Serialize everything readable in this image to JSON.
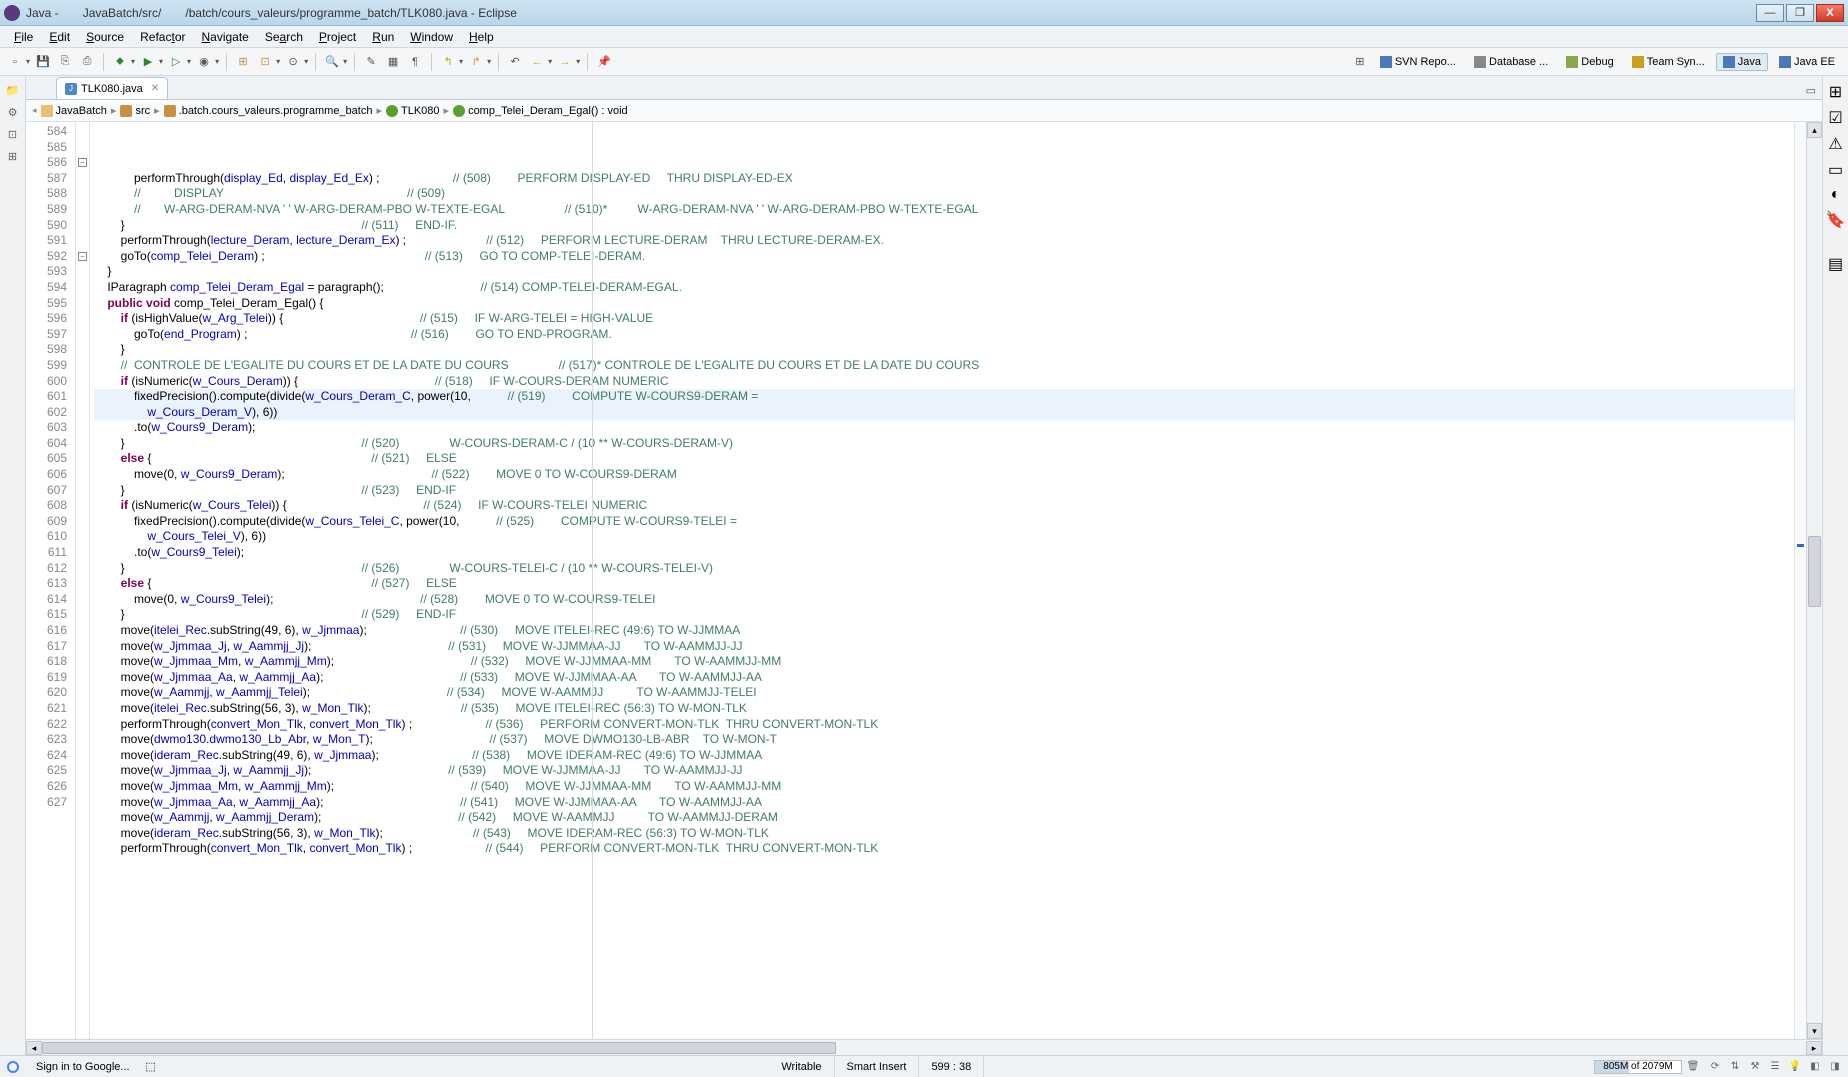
{
  "title": {
    "seg1": "Java -",
    "seg2": "JavaBatch/src/",
    "seg3": "/batch/cours_valeurs/programme_batch/TLK080.java - Eclipse"
  },
  "window_buttons": {
    "min": "—",
    "max": "❐",
    "close": "X"
  },
  "menu": [
    "File",
    "Edit",
    "Source",
    "Refactor",
    "Navigate",
    "Search",
    "Project",
    "Run",
    "Window",
    "Help"
  ],
  "perspectives": [
    {
      "label": "SVN Repo...",
      "active": false
    },
    {
      "label": "Database ...",
      "active": false
    },
    {
      "label": "Debug",
      "active": false
    },
    {
      "label": "Team Syn...",
      "active": false
    },
    {
      "label": "Java",
      "active": true
    },
    {
      "label": "Java EE",
      "active": false
    }
  ],
  "tab": {
    "name": "TLK080.java"
  },
  "breadcrumb": {
    "project": "JavaBatch",
    "src": "src",
    "pkg": ".batch.cours_valeurs.programme_batch",
    "class": "TLK080",
    "method": "comp_Telei_Deram_Egal() : void"
  },
  "code": {
    "first_line": 584,
    "highlighted": [
      598,
      599
    ],
    "fold_markers": [
      586,
      592
    ],
    "lines": [
      "            performThrough(<f>display_Ed</f>, <f>display_Ed_Ex</f>) ;                      <c>// (508)        PERFORM DISPLAY-ED     THRU DISPLAY-ED-EX</c>",
      "            <c>//          DISPLAY</c>                                                       <c>// (509)</c>",
      "            <c>//       W-ARG-DERAM-NVA ' ' W-ARG-DERAM-PBO W-TEXTE-EGAL</c>                  <c>// (510)*         W-ARG-DERAM-NVA ' ' W-ARG-DERAM-PBO W-TEXTE-EGAL</c>",
      "        }                                                                       <c>// (511)     END-IF.</c>",
      "        performThrough(<f>lecture_Deram</f>, <f>lecture_Deram_Ex</f>) ;                        <c>// (512)     PERFORM LECTURE-DERAM    THRU LECTURE-DERAM-EX.</c>",
      "        goTo(<f>comp_Telei_Deram</f>) ;                                                <c>// (513)     GO TO COMP-TELEI-DERAM.</c>",
      "    }",
      "    IParagraph <f>comp_Telei_Deram_Egal</f> = paragraph();                             <c>// (514) COMP-TELEI-DERAM-EGAL.</c>",
      "    <k>public</k> <k>void</k> comp_Telei_Deram_Egal() {",
      "        <k>if</k> (isHighValue(<f>w_Arg_Telei</f>)) {                                         <c>// (515)     IF W-ARG-TELEI = HIGH-VALUE</c>",
      "            goTo(<f>end_Program</f>) ;                                                 <c>// (516)        GO TO END-PROGRAM.</c>",
      "        }",
      "        <c>//  CONTROLE DE L'EGALITE DU COURS ET DE LA DATE DU COURS</c>               <c>// (517)* CONTROLE DE L'EGALITE DU COURS ET DE LA DATE DU COURS</c>",
      "        <k>if</k> (isNumeric(<f>w_Cours_Deram</f>)) {                                         <c>// (518)     IF W-COURS-DERAM NUMERIC</c>",
      "            fixedPrecision().compute(divide(<f>w_Cours_Deram_C</f>, power(10,           <c>// (519)        COMPUTE W-COURS9-DERAM =</c>",
      "                <f>w_Cours_Deram_V</f>), 6))",
      "            .to(<f>w_Cours9_Deram</f>);",
      "        }                                                                       <c>// (520)               W-COURS-DERAM-C / (10 ** W-COURS-DERAM-V)</c>",
      "        <k>else</k> {                                                                  <c>// (521)     ELSE</c>",
      "            move(0, <f>w_Cours9_Deram</f>);                                            <c>// (522)        MOVE 0 TO W-COURS9-DERAM</c>",
      "        }                                                                       <c>// (523)     END-IF</c>",
      "        <k>if</k> (isNumeric(<f>w_Cours_Telei</f>)) {                                         <c>// (524)     IF W-COURS-TELEI NUMERIC</c>",
      "            fixedPrecision().compute(divide(<f>w_Cours_Telei_C</f>, power(10,           <c>// (525)        COMPUTE W-COURS9-TELEI =</c>",
      "                <f>w_Cours_Telei_V</f>), 6))",
      "            .to(<f>w_Cours9_Telei</f>);",
      "        }                                                                       <c>// (526)               W-COURS-TELEI-C / (10 ** W-COURS-TELEI-V)</c>",
      "        <k>else</k> {                                                                  <c>// (527)     ELSE</c>",
      "            move(0, <f>w_Cours9_Telei</f>);                                            <c>// (528)        MOVE 0 TO W-COURS9-TELEI</c>",
      "        }                                                                       <c>// (529)     END-IF</c>",
      "        move(<f>itelei_Rec</f>.subString(49, 6), <f>w_Jjmmaa</f>);                            <c>// (530)     MOVE ITELEI-REC (49:6) TO W-JJMMAA</c>",
      "        move(<f>w_Jjmmaa_Jj</f>, <f>w_Aammjj_Jj</f>);                                         <c>// (531)     MOVE W-JJMMAA-JJ       TO W-AAMMJJ-JJ</c>",
      "        move(<f>w_Jjmmaa_Mm</f>, <f>w_Aammjj_Mm</f>);                                         <c>// (532)     MOVE W-JJMMAA-MM       TO W-AAMMJJ-MM</c>",
      "        move(<f>w_Jjmmaa_Aa</f>, <f>w_Aammjj_Aa</f>);                                         <c>// (533)     MOVE W-JJMMAA-AA       TO W-AAMMJJ-AA</c>",
      "        move(<f>w_Aammjj</f>, <f>w_Aammjj_Telei</f>);                                         <c>// (534)     MOVE W-AAMMJJ          TO W-AAMMJJ-TELEI</c>",
      "        move(<f>itelei_Rec</f>.subString(56, 3), <f>w_Mon_Tlk</f>);                           <c>// (535)     MOVE ITELEI-REC (56:3) TO W-MON-TLK</c>",
      "        performThrough(<f>convert_Mon_Tlk</f>, <f>convert_Mon_Tlk</f>) ;                      <c>// (536)     PERFORM CONVERT-MON-TLK  THRU CONVERT-MON-TLK</c>",
      "        move(<f>dwmo130</f>.<f>dwmo130_Lb_Abr</f>, <f>w_Mon_T</f>);                                   <c>// (537)     MOVE DWMO130-LB-ABR    TO W-MON-T</c>",
      "        move(<f>ideram_Rec</f>.subString(49, 6), <f>w_Jjmmaa</f>);                            <c>// (538)     MOVE IDERAM-REC (49:6) TO W-JJMMAA</c>",
      "        move(<f>w_Jjmmaa_Jj</f>, <f>w_Aammjj_Jj</f>);                                         <c>// (539)     MOVE W-JJMMAA-JJ       TO W-AAMMJJ-JJ</c>",
      "        move(<f>w_Jjmmaa_Mm</f>, <f>w_Aammjj_Mm</f>);                                         <c>// (540)     MOVE W-JJMMAA-MM       TO W-AAMMJJ-MM</c>",
      "        move(<f>w_Jjmmaa_Aa</f>, <f>w_Aammjj_Aa</f>);                                         <c>// (541)     MOVE W-JJMMAA-AA       TO W-AAMMJJ-AA</c>",
      "        move(<f>w_Aammjj</f>, <f>w_Aammjj_Deram</f>);                                         <c>// (542)     MOVE W-AAMMJJ          TO W-AAMMJJ-DERAM</c>",
      "        move(<f>ideram_Rec</f>.subString(56, 3), <f>w_Mon_Tlk</f>);                           <c>// (543)     MOVE IDERAM-REC (56:3) TO W-MON-TLK</c>",
      "        performThrough(<f>convert_Mon_Tlk</f>, <f>convert_Mon_Tlk</f>) ;                      <c>// (544)     PERFORM CONVERT-MON-TLK  THRU CONVERT-MON-TLK</c>"
    ]
  },
  "status": {
    "signin": "Sign in to Google...",
    "writable": "Writable",
    "insert": "Smart Insert",
    "cursor": "599 : 38",
    "memory": "805M of 2079M"
  }
}
